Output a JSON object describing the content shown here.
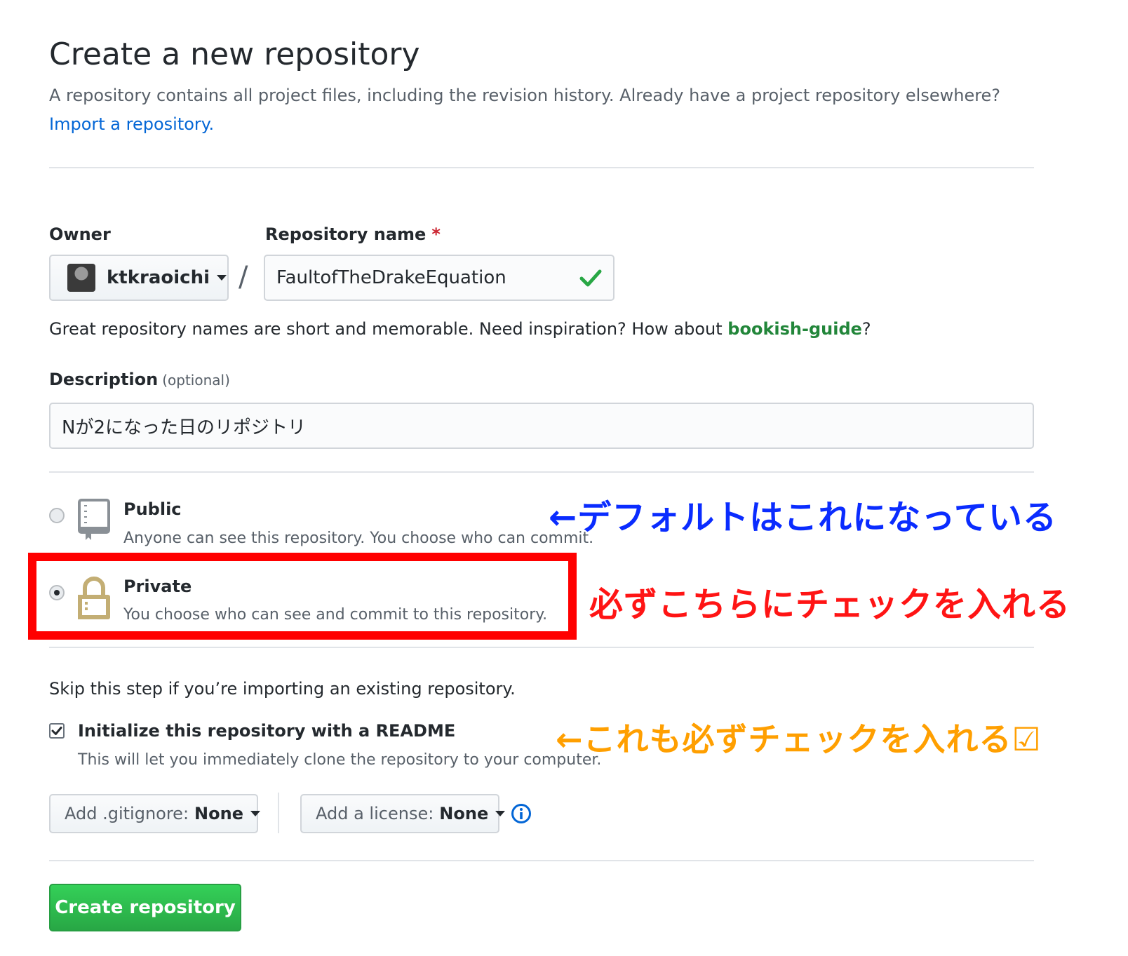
{
  "page": {
    "title": "Create a new repository",
    "subtitle": "A repository contains all project files, including the revision history. Already have a project repository elsewhere?",
    "import_link": "Import a repository."
  },
  "owner": {
    "label": "Owner",
    "name": "ktkraoichi"
  },
  "repo_name": {
    "label": "Repository name",
    "required_mark": "*",
    "value": "FaultofTheDrakeEquation",
    "separator": "/",
    "status_icon": "check-icon",
    "hint_prefix": "Great repository names are short and memorable. Need inspiration? How about",
    "suggestion": "bookish-guide",
    "hint_suffix": "?"
  },
  "description": {
    "label": "Description",
    "optional": "(optional)",
    "value": "Nが2になった日のリポジトリ"
  },
  "visibility": {
    "public": {
      "title": "Public",
      "desc": "Anyone can see this repository. You choose who can commit.",
      "selected": false,
      "icon": "repo-book-icon"
    },
    "private": {
      "title": "Private",
      "desc": "You choose who can see and commit to this repository.",
      "selected": true,
      "icon": "lock-icon"
    }
  },
  "init": {
    "skip_text": "Skip this step if you’re importing an existing repository.",
    "readme_label": "Initialize this repository with a README",
    "readme_desc": "This will let you immediately clone the repository to your computer.",
    "readme_checked": true
  },
  "gitignore": {
    "label": "Add .gitignore:",
    "value": "None"
  },
  "license": {
    "label": "Add a license:",
    "value": "None"
  },
  "create_button": "Create repository",
  "annotations": {
    "public_note": "←デフォルトはこれになっている",
    "private_note": "必ずこちらにチェックを入れる",
    "readme_note": "←これも必ずチェックを入れる☑",
    "colors": {
      "blue": "#0a2cff",
      "red": "#ff1414",
      "orange": "#ff9f00"
    }
  },
  "colors": {
    "link": "#0366d6",
    "suggestion": "#22863a",
    "create_button": "#2cbe4e",
    "required": "#cb2431"
  }
}
